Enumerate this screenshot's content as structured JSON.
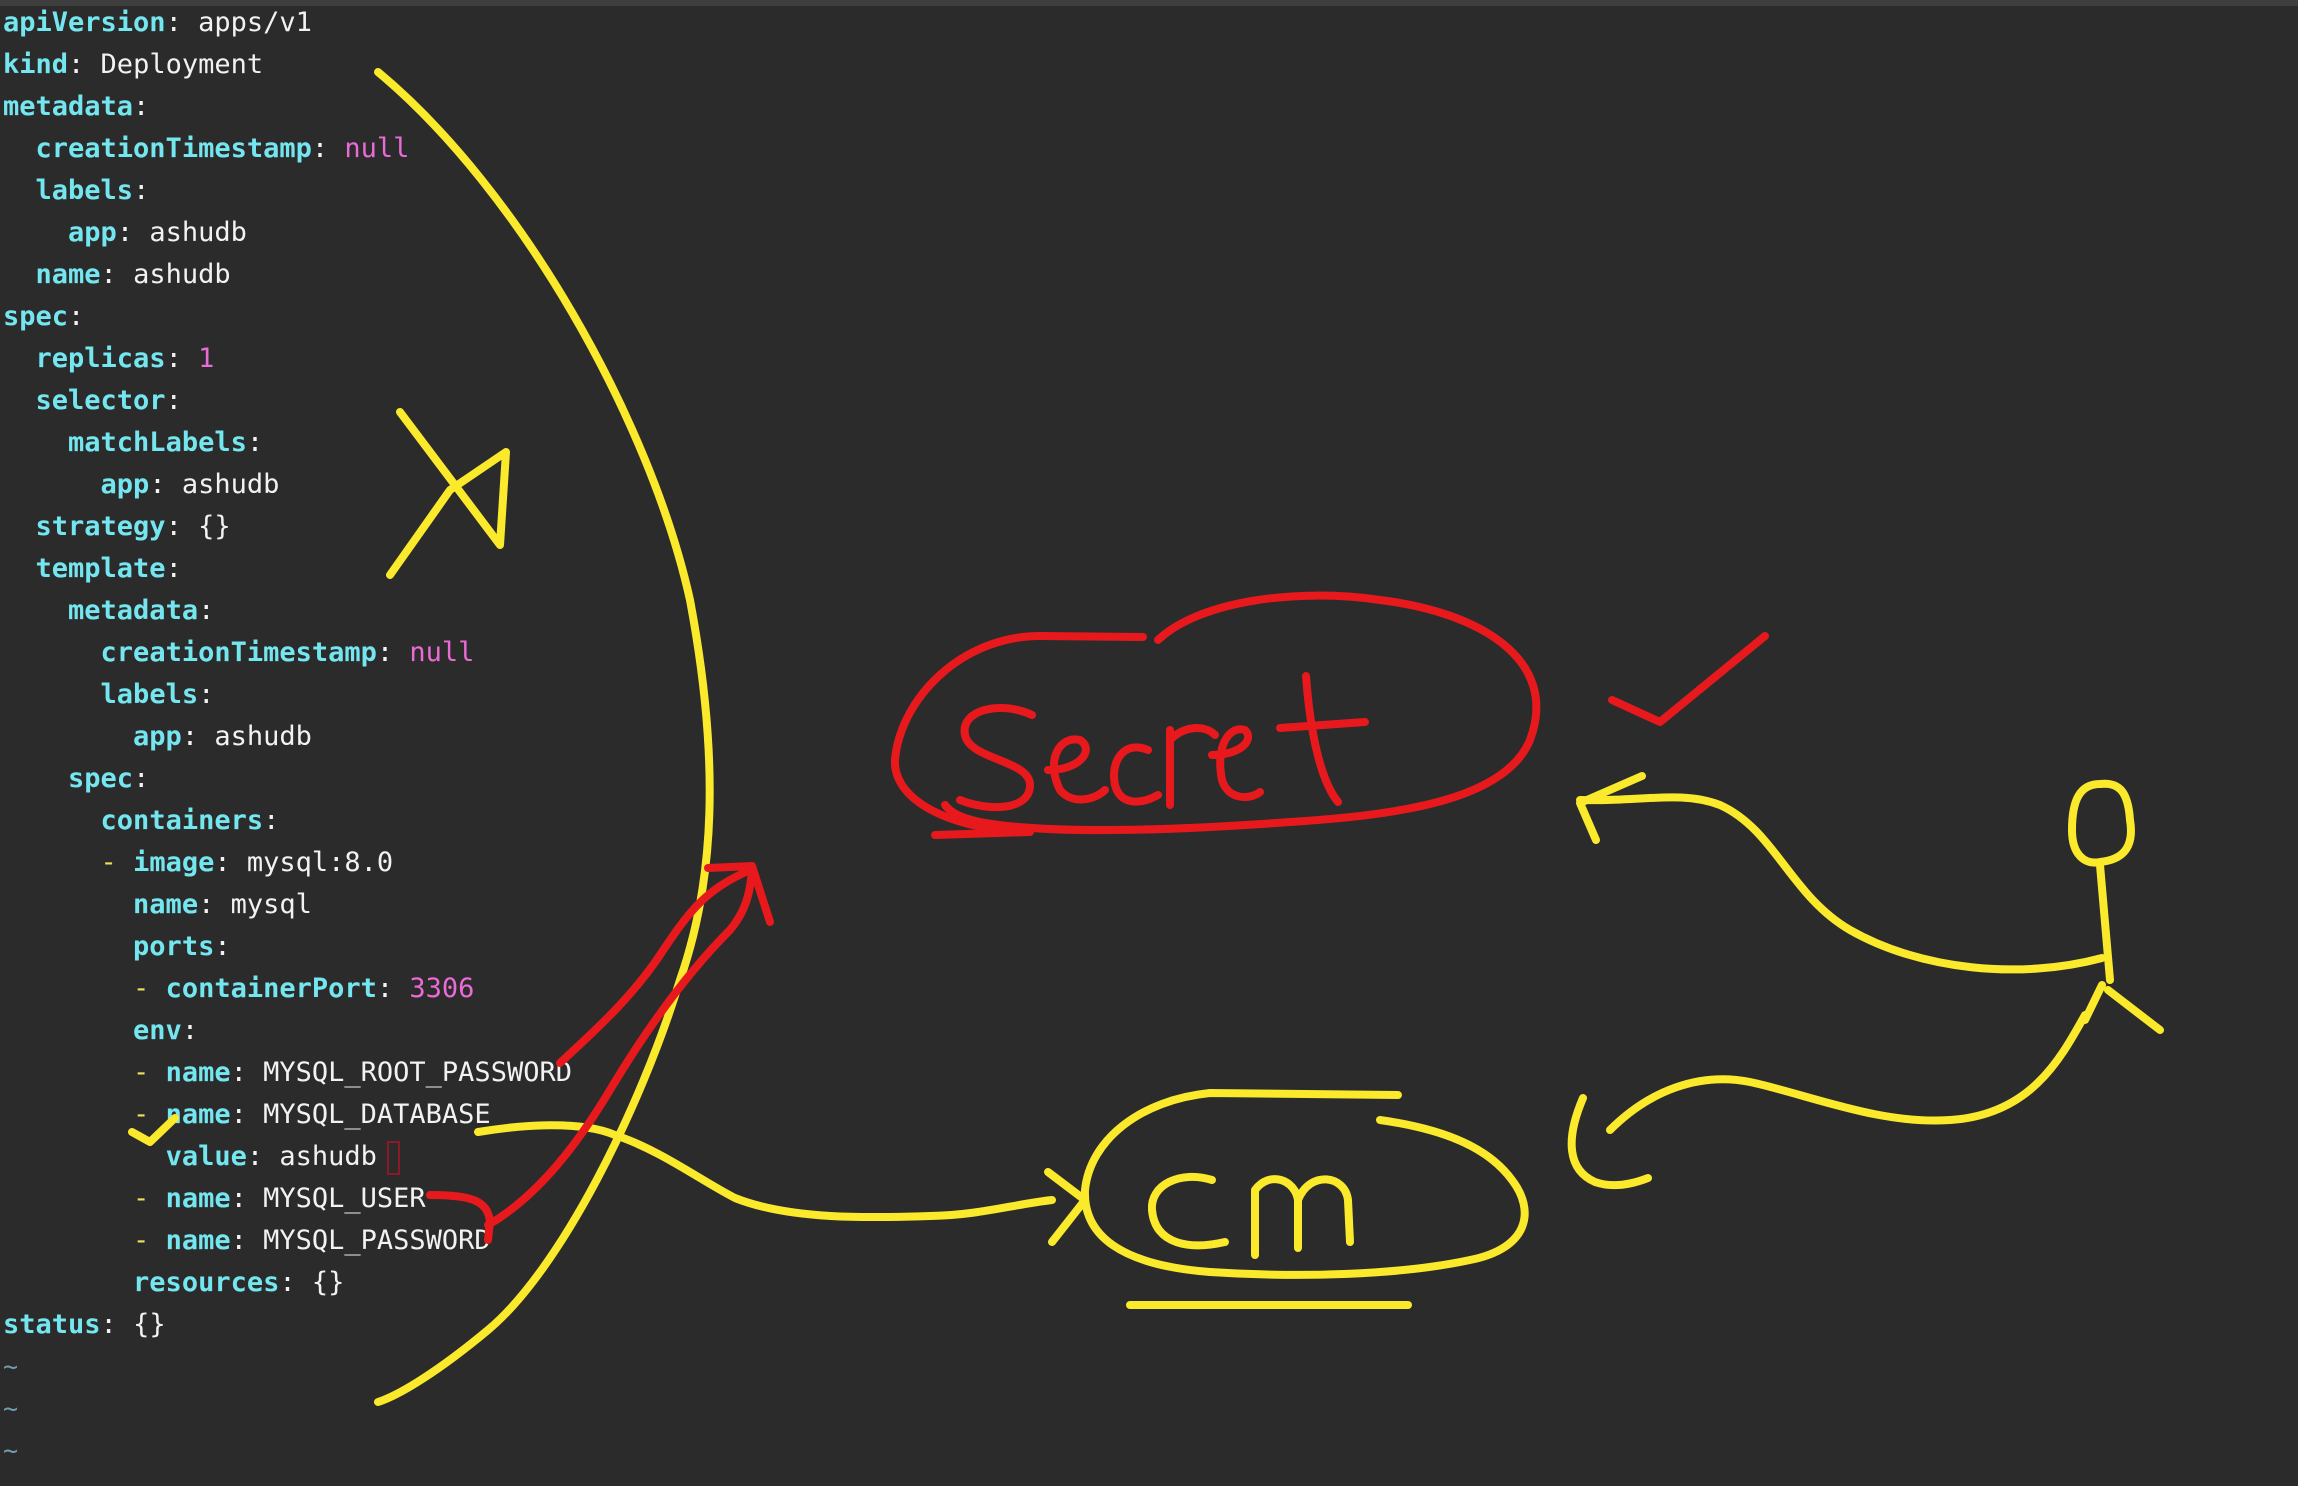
{
  "editor": {
    "lines": [
      {
        "indent": "",
        "dash": "",
        "key": "apiVersion",
        "colon": ":",
        "value": " apps/v1",
        "type": "str"
      },
      {
        "indent": "",
        "dash": "",
        "key": "kind",
        "colon": ":",
        "value": " Deployment",
        "type": "str"
      },
      {
        "indent": "",
        "dash": "",
        "key": "metadata",
        "colon": ":",
        "value": "",
        "type": "str"
      },
      {
        "indent": "  ",
        "dash": "",
        "key": "creationTimestamp",
        "colon": ":",
        "value": " null",
        "type": "nul"
      },
      {
        "indent": "  ",
        "dash": "",
        "key": "labels",
        "colon": ":",
        "value": "",
        "type": "str"
      },
      {
        "indent": "    ",
        "dash": "",
        "key": "app",
        "colon": ":",
        "value": " ashudb",
        "type": "str"
      },
      {
        "indent": "  ",
        "dash": "",
        "key": "name",
        "colon": ":",
        "value": " ashudb",
        "type": "str"
      },
      {
        "indent": "",
        "dash": "",
        "key": "spec",
        "colon": ":",
        "value": "",
        "type": "str"
      },
      {
        "indent": "  ",
        "dash": "",
        "key": "replicas",
        "colon": ":",
        "value": " 1",
        "type": "num"
      },
      {
        "indent": "  ",
        "dash": "",
        "key": "selector",
        "colon": ":",
        "value": "",
        "type": "str"
      },
      {
        "indent": "    ",
        "dash": "",
        "key": "matchLabels",
        "colon": ":",
        "value": "",
        "type": "str"
      },
      {
        "indent": "      ",
        "dash": "",
        "key": "app",
        "colon": ":",
        "value": " ashudb",
        "type": "str"
      },
      {
        "indent": "  ",
        "dash": "",
        "key": "strategy",
        "colon": ":",
        "value": " {}",
        "type": "str"
      },
      {
        "indent": "  ",
        "dash": "",
        "key": "template",
        "colon": ":",
        "value": "",
        "type": "str"
      },
      {
        "indent": "    ",
        "dash": "",
        "key": "metadata",
        "colon": ":",
        "value": "",
        "type": "str"
      },
      {
        "indent": "      ",
        "dash": "",
        "key": "creationTimestamp",
        "colon": ":",
        "value": " null",
        "type": "nul"
      },
      {
        "indent": "      ",
        "dash": "",
        "key": "labels",
        "colon": ":",
        "value": "",
        "type": "str"
      },
      {
        "indent": "        ",
        "dash": "",
        "key": "app",
        "colon": ":",
        "value": " ashudb",
        "type": "str"
      },
      {
        "indent": "    ",
        "dash": "",
        "key": "spec",
        "colon": ":",
        "value": "",
        "type": "str"
      },
      {
        "indent": "      ",
        "dash": "",
        "key": "containers",
        "colon": ":",
        "value": "",
        "type": "str"
      },
      {
        "indent": "      ",
        "dash": "- ",
        "key": "image",
        "colon": ":",
        "value": " mysql:8.0",
        "type": "str"
      },
      {
        "indent": "        ",
        "dash": "",
        "key": "name",
        "colon": ":",
        "value": " mysql",
        "type": "str"
      },
      {
        "indent": "        ",
        "dash": "",
        "key": "ports",
        "colon": ":",
        "value": "",
        "type": "str"
      },
      {
        "indent": "        ",
        "dash": "- ",
        "key": "containerPort",
        "colon": ":",
        "value": " 3306",
        "type": "num"
      },
      {
        "indent": "        ",
        "dash": "",
        "key": "env",
        "colon": ":",
        "value": "",
        "type": "str"
      },
      {
        "indent": "        ",
        "dash": "- ",
        "key": "name",
        "colon": ":",
        "value": " MYSQL_ROOT_PASSWORD",
        "type": "str"
      },
      {
        "indent": "        ",
        "dash": "- ",
        "key": "name",
        "colon": ":",
        "value": " MYSQL_DATABASE",
        "type": "str"
      },
      {
        "indent": "          ",
        "dash": "",
        "key": "value",
        "colon": ":",
        "value": " ashudb",
        "type": "str",
        "cursor": true
      },
      {
        "indent": "        ",
        "dash": "- ",
        "key": "name",
        "colon": ":",
        "value": " MYSQL_USER",
        "type": "str"
      },
      {
        "indent": "        ",
        "dash": "- ",
        "key": "name",
        "colon": ":",
        "value": " MYSQL_PASSWORD",
        "type": "str"
      },
      {
        "indent": "        ",
        "dash": "",
        "key": "resources",
        "colon": ":",
        "value": " {}",
        "type": "str"
      },
      {
        "indent": "",
        "dash": "",
        "key": "status",
        "colon": ":",
        "value": " {}",
        "type": "str"
      }
    ],
    "tildes": [
      "~",
      "~",
      "~"
    ]
  },
  "annotations": {
    "colors": {
      "yellow": "#fbe92c",
      "red": "#e8191c"
    },
    "handwriting": [
      "Secret",
      "Cm"
    ]
  },
  "colors": {
    "background": "#2b2b2b",
    "key": "#74e6f0",
    "text": "#f2f2f2",
    "number": "#ea6bd6",
    "dash": "#e7e15e",
    "tilde": "#6f9fb0"
  }
}
